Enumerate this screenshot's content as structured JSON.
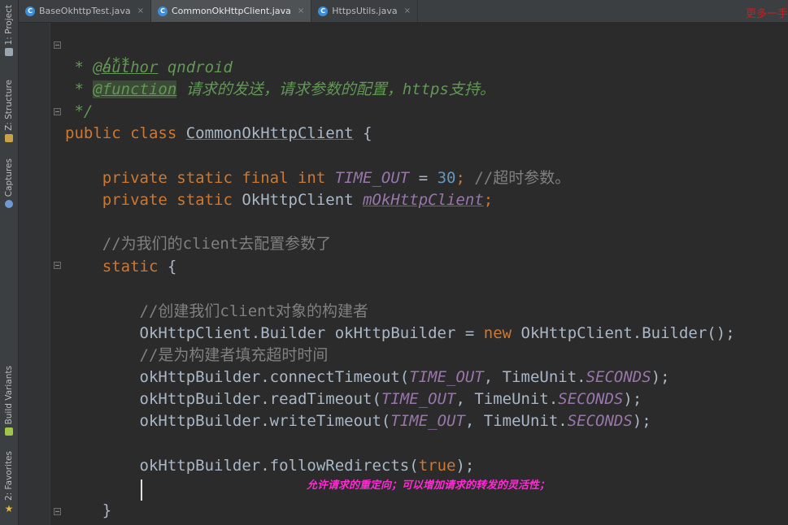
{
  "tool_windows": [
    {
      "label": "1: Project",
      "icon": "project-icon",
      "color": "#9aa7b0"
    },
    {
      "label": "Z: Structure",
      "icon": "structure-icon",
      "color": "#c7a247"
    },
    {
      "label": "Captures",
      "icon": "captures-icon",
      "color": "#6f9ad1"
    },
    {
      "label": "Build Variants",
      "icon": "android-icon",
      "color": "#9fc54a"
    },
    {
      "label": "2: Favorites",
      "icon": "star-icon",
      "color": "#e8b43a"
    }
  ],
  "tabs": [
    {
      "label": "BaseOkhttpTest.java",
      "close": "×",
      "icon_letter": "C"
    },
    {
      "label": "CommonOkHttpClient.java",
      "close": "×",
      "icon_letter": "C"
    },
    {
      "label": "HttpsUtils.java",
      "close": "×",
      "icon_letter": "C"
    }
  ],
  "watermark": "更多一手",
  "code": {
    "l1": {
      "open": "/**"
    },
    "l2": {
      "star": " * ",
      "tag": "@author",
      "text": " qndroid"
    },
    "l3": {
      "star": " * ",
      "tag": "@function",
      "text": " 请求的发送，请求参数的配置，https支持。"
    },
    "l4": {
      "close": " */"
    },
    "l5": {
      "kw": "public class ",
      "cls": "CommonOkHttpClient",
      "rest": " {"
    },
    "l6": {
      "kw": "    private static final int ",
      "const": "TIME_OUT",
      "op": " = ",
      "num": "30",
      "semi": ";",
      "cm": " //超时参数。"
    },
    "l7": {
      "kw": "    private static ",
      "type": "OkHttpClient ",
      "field": "mOkHttpClient",
      "semi": ";"
    },
    "l8": {
      "cm": "    //为我们的client去配置参数了"
    },
    "l9": {
      "kw": "    static",
      "rest": " {"
    },
    "l10": {
      "cm": "        //创建我们client对象的构建者"
    },
    "l11": {
      "a": "        OkHttpClient.Builder okHttpBuilder = ",
      "kw": "new",
      "b": " OkHttpClient.Builder();"
    },
    "l12": {
      "cm": "        //是为构建者填充超时时间"
    },
    "l13": {
      "a": "        okHttpBuilder.connectTimeout(",
      "const": "TIME_OUT",
      "b": ", TimeUnit.",
      "const2": "SECONDS",
      "c": ");"
    },
    "l14": {
      "a": "        okHttpBuilder.readTimeout(",
      "const": "TIME_OUT",
      "b": ", TimeUnit.",
      "const2": "SECONDS",
      "c": ");"
    },
    "l15": {
      "a": "        okHttpBuilder.writeTimeout(",
      "const": "TIME_OUT",
      "b": ", TimeUnit.",
      "const2": "SECONDS",
      "c": ");"
    },
    "l16": {
      "a": "        okHttpBuilder.followRedirects(",
      "kw": "true",
      "b": ");"
    },
    "l17": {
      "rest": "    }"
    }
  },
  "subtitle": "允许请求的重定向；可以增加请求的转发的灵活性；",
  "colors": {
    "keyword": "#cc7832",
    "comment": "#808080",
    "doc_comment": "#629755",
    "constant": "#9876aa",
    "number": "#6897bb",
    "text": "#a9b7c6",
    "subtitle": "#ff2ad4",
    "watermark": "#d11b1b"
  }
}
